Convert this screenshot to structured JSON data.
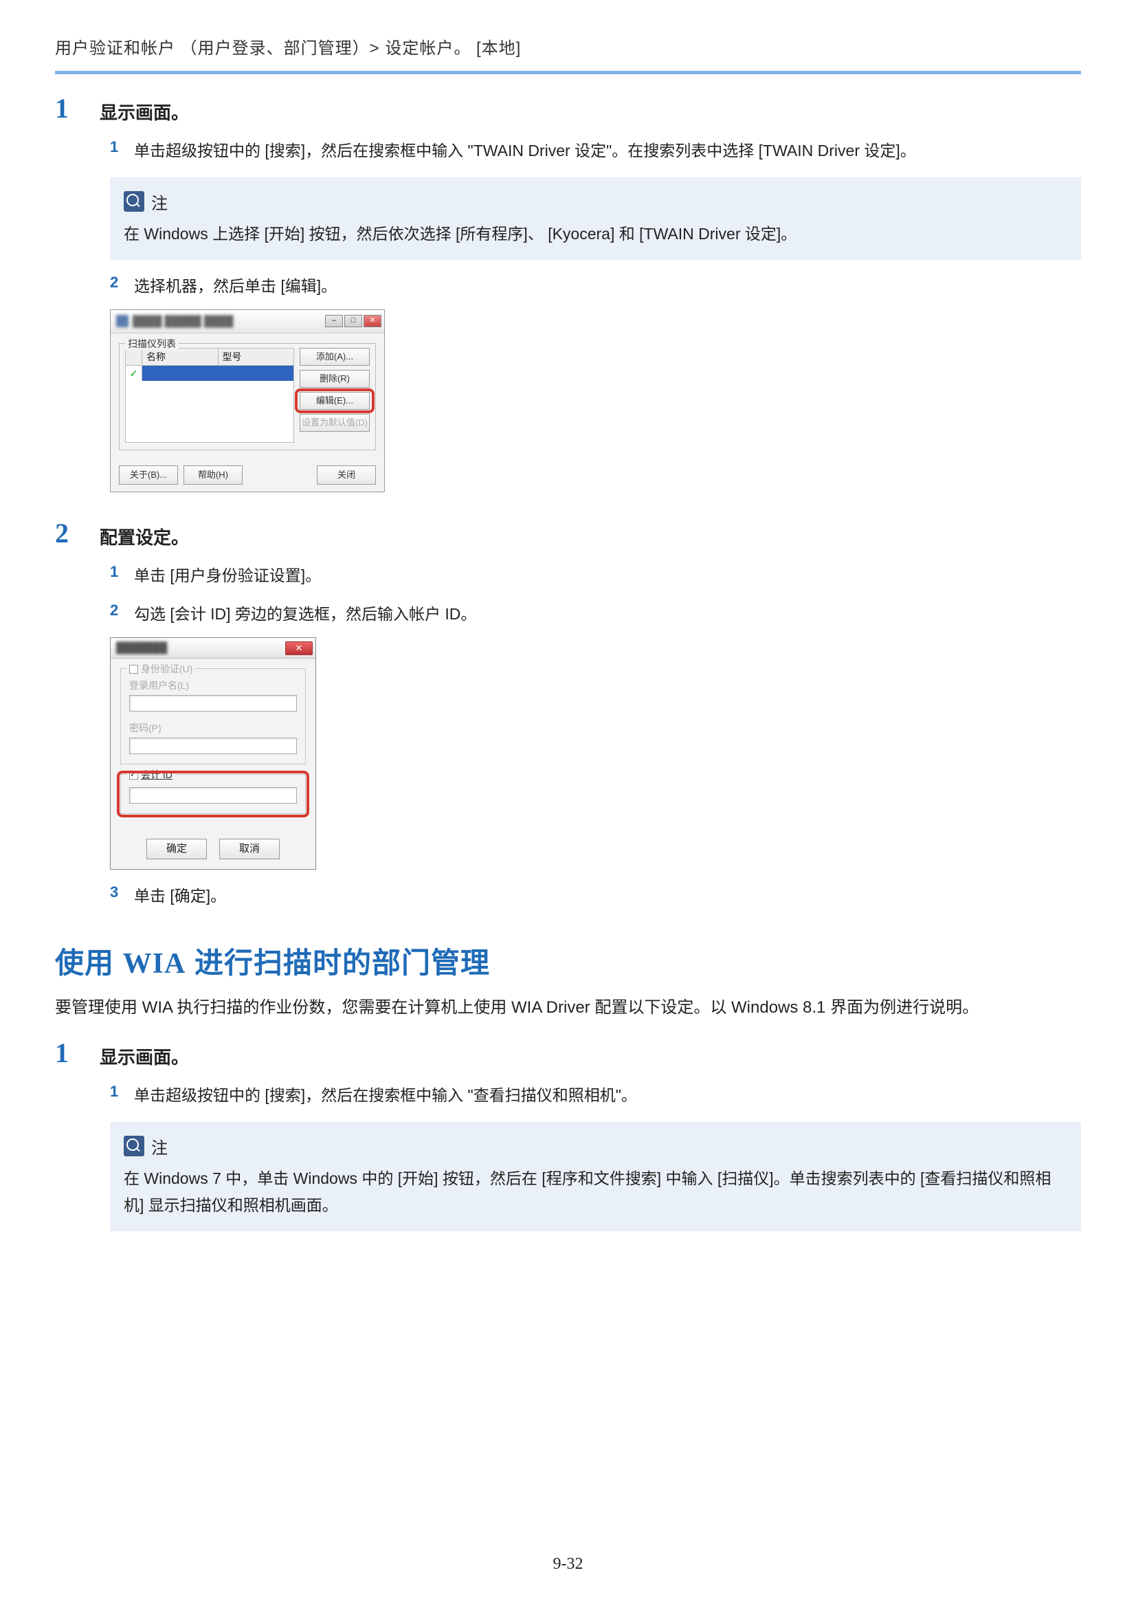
{
  "breadcrumb": "用户验证和帐户 （用户登录、部门管理）> 设定帐户。 [本地]",
  "step1": {
    "num": "1",
    "title": "显示画面。",
    "s1_num": "1",
    "s1_text": "单击超级按钮中的 [搜索]，然后在搜索框中输入 \"TWAIN Driver 设定\"。在搜索列表中选择 [TWAIN Driver 设定]。",
    "note_label": "注",
    "note_body": "在 Windows 上选择 [开始] 按钮，然后依次选择 [所有程序]、 [Kyocera] 和 [TWAIN Driver 设定]。",
    "s2_num": "2",
    "s2_text": "选择机器，然后单击 [编辑]。"
  },
  "dialog1": {
    "legend": "扫描仪列表",
    "col_name": "名称",
    "col_model": "型号",
    "btn_add": "添加(A)...",
    "btn_del": "删除(R)",
    "btn_edit": "编辑(E)...",
    "btn_default": "设置为默认值(D)",
    "btn_about": "关于(B)...",
    "btn_help": "帮助(H)",
    "btn_close": "关闭"
  },
  "step2": {
    "num": "2",
    "title": "配置设定。",
    "s1_num": "1",
    "s1_text": "单击 [用户身份验证设置]。",
    "s2_num": "2",
    "s2_text": "勾选 [会计 ID] 旁边的复选框，然后输入帐户 ID。",
    "s3_num": "3",
    "s3_text": "单击 [确定]。"
  },
  "dialog2": {
    "fs1_legend": "身份验证(U)",
    "lbl_user": "登录用户名(L)",
    "lbl_pass": "密码(P)",
    "fs2_label": "会计 ID",
    "btn_ok": "确定",
    "btn_cancel": "取消"
  },
  "section2": {
    "heading_pre": "使用 ",
    "heading_latin": "WIA",
    "heading_post": " 进行扫描时的部门管理",
    "intro": "要管理使用 WIA 执行扫描的作业份数，您需要在计算机上使用 WIA Driver 配置以下设定。以 Windows 8.1 界面为例进行说明。"
  },
  "step3": {
    "num": "1",
    "title": "显示画面。",
    "s1_num": "1",
    "s1_text": "单击超级按钮中的 [搜索]，然后在搜索框中输入 \"查看扫描仪和照相机\"。",
    "note_label": "注",
    "note_body": "在 Windows 7 中，单击 Windows 中的 [开始] 按钮，然后在 [程序和文件搜索] 中输入 [扫描仪]。单击搜索列表中的 [查看扫描仪和照相机] 显示扫描仪和照相机画面。"
  },
  "page_number": "9-32"
}
